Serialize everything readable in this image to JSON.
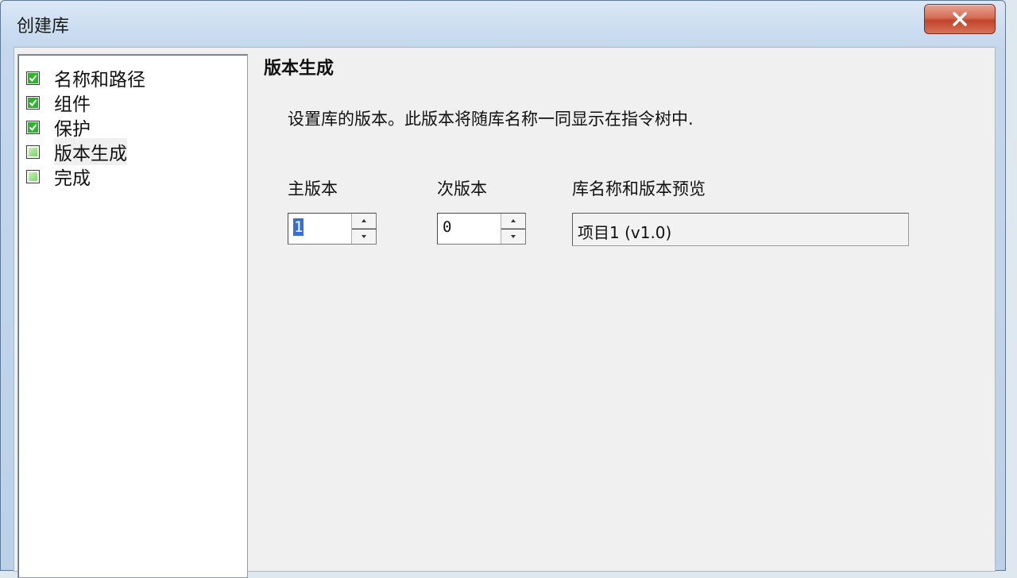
{
  "window": {
    "title": "创建库",
    "close_label": "✕"
  },
  "nav": {
    "items": [
      {
        "label": "名称和路径",
        "checked": true
      },
      {
        "label": "组件",
        "checked": true
      },
      {
        "label": "保护",
        "checked": true
      },
      {
        "label": "版本生成",
        "checked": false
      },
      {
        "label": "完成",
        "checked": false
      }
    ]
  },
  "content": {
    "section_title": "版本生成",
    "description": "设置库的版本。此版本将随库名称一同显示在指令树中.",
    "major": {
      "label": "主版本",
      "value": "1"
    },
    "minor": {
      "label": "次版本",
      "value": "0"
    },
    "preview": {
      "label": "库名称和版本预览",
      "value": "项目1 (v1.0)"
    }
  },
  "icons": {
    "close": "close-icon",
    "checkbox": "checkbox-icon",
    "spin_up": "spin-up-icon",
    "spin_down": "spin-down-icon"
  },
  "colors": {
    "check_green": "#2eb52e",
    "close_red": "#c2442a",
    "selection_blue": "#3470d6"
  }
}
